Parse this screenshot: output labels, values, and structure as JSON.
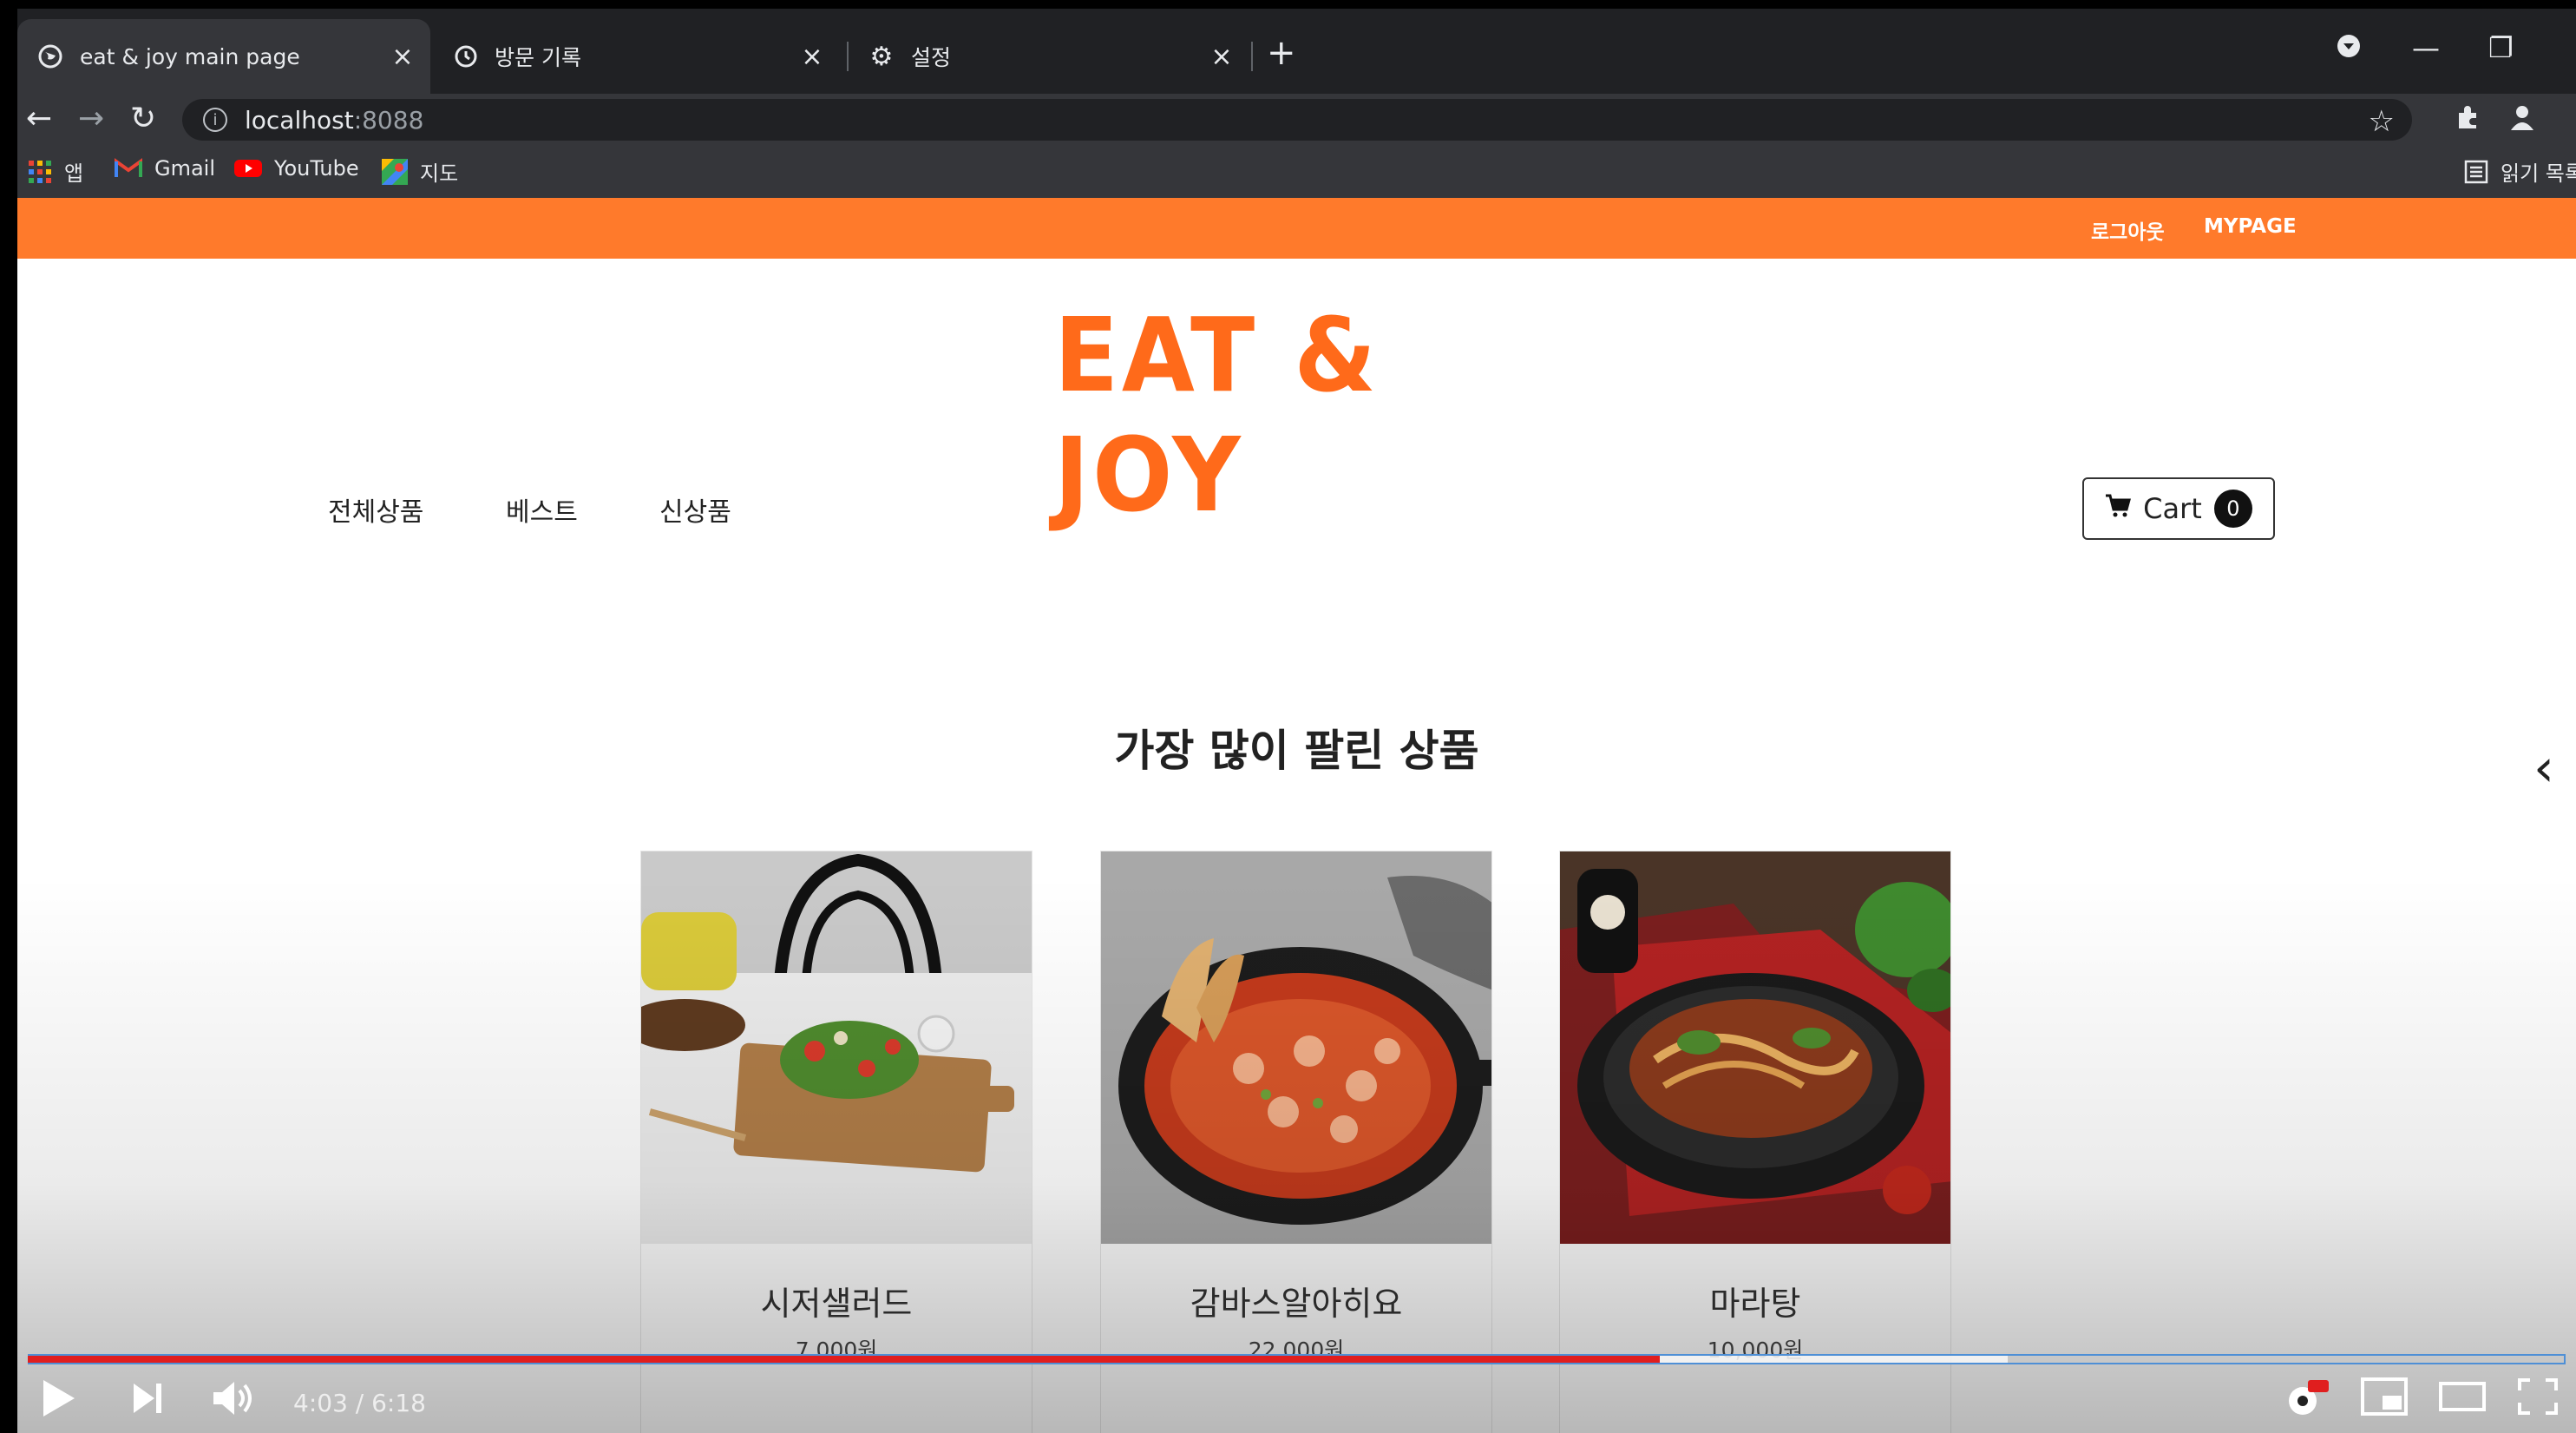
{
  "browser": {
    "tabs": [
      {
        "title": "eat & joy main page",
        "icon": "globe-icon",
        "active": true
      },
      {
        "title": "방문 기록",
        "icon": "history-icon",
        "active": false
      },
      {
        "title": "설정",
        "icon": "gear-icon",
        "active": false
      }
    ],
    "new_tab": "+",
    "address": {
      "host": "localhost",
      "port": ":8088"
    },
    "bookmarks": [
      {
        "label": "앱",
        "icon": "apps-grid-icon"
      },
      {
        "label": "Gmail",
        "icon": "gmail-icon"
      },
      {
        "label": "YouTube",
        "icon": "youtube-icon"
      },
      {
        "label": "지도",
        "icon": "maps-icon"
      }
    ],
    "reading_list": "읽기 목록"
  },
  "site": {
    "top_links": {
      "logout": "로그아웃",
      "mypage": "MYPAGE"
    },
    "logo": "EAT & JOY",
    "menu": [
      "전체상품",
      "베스트",
      "신상품"
    ],
    "cart": {
      "label": "Cart",
      "count": "0"
    },
    "section_title": "가장 많이 팔린 상품",
    "products": [
      {
        "name": "시저샐러드",
        "price": "7,000원"
      },
      {
        "name": "감바스알아히요",
        "price": "22,000원"
      },
      {
        "name": "마라탕",
        "price": "10,000원"
      }
    ]
  },
  "video": {
    "time": "4:03 / 6:18",
    "progress_fraction": 0.643,
    "buffer_fraction": 0.78
  },
  "colors": {
    "accent": "#ff7a2b",
    "logo": "#ff6a1a",
    "played": "#e01e1e"
  }
}
